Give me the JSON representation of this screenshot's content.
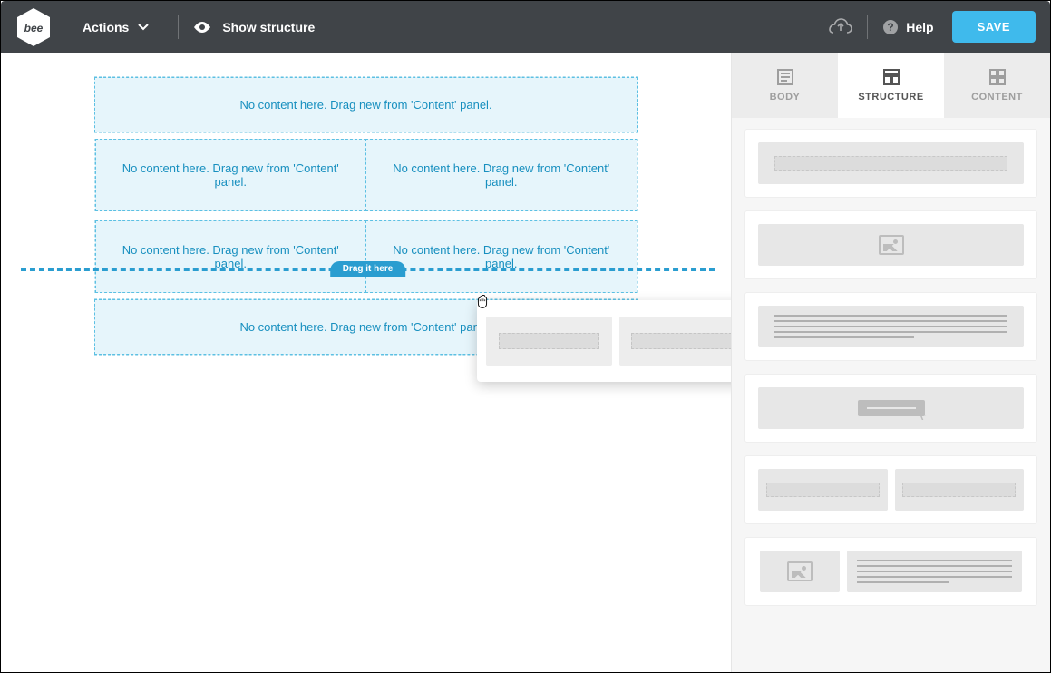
{
  "header": {
    "logo_text": "bee",
    "actions_label": "Actions",
    "show_structure_label": "Show structure",
    "help_label": "Help",
    "save_label": "SAVE"
  },
  "canvas": {
    "placeholder_text": "No content here. Drag new from 'Content' panel.",
    "drop_hint": "Drag it here"
  },
  "sidepanel": {
    "tabs": {
      "body": "BODY",
      "structure": "STRUCTURE",
      "content": "CONTENT"
    }
  }
}
